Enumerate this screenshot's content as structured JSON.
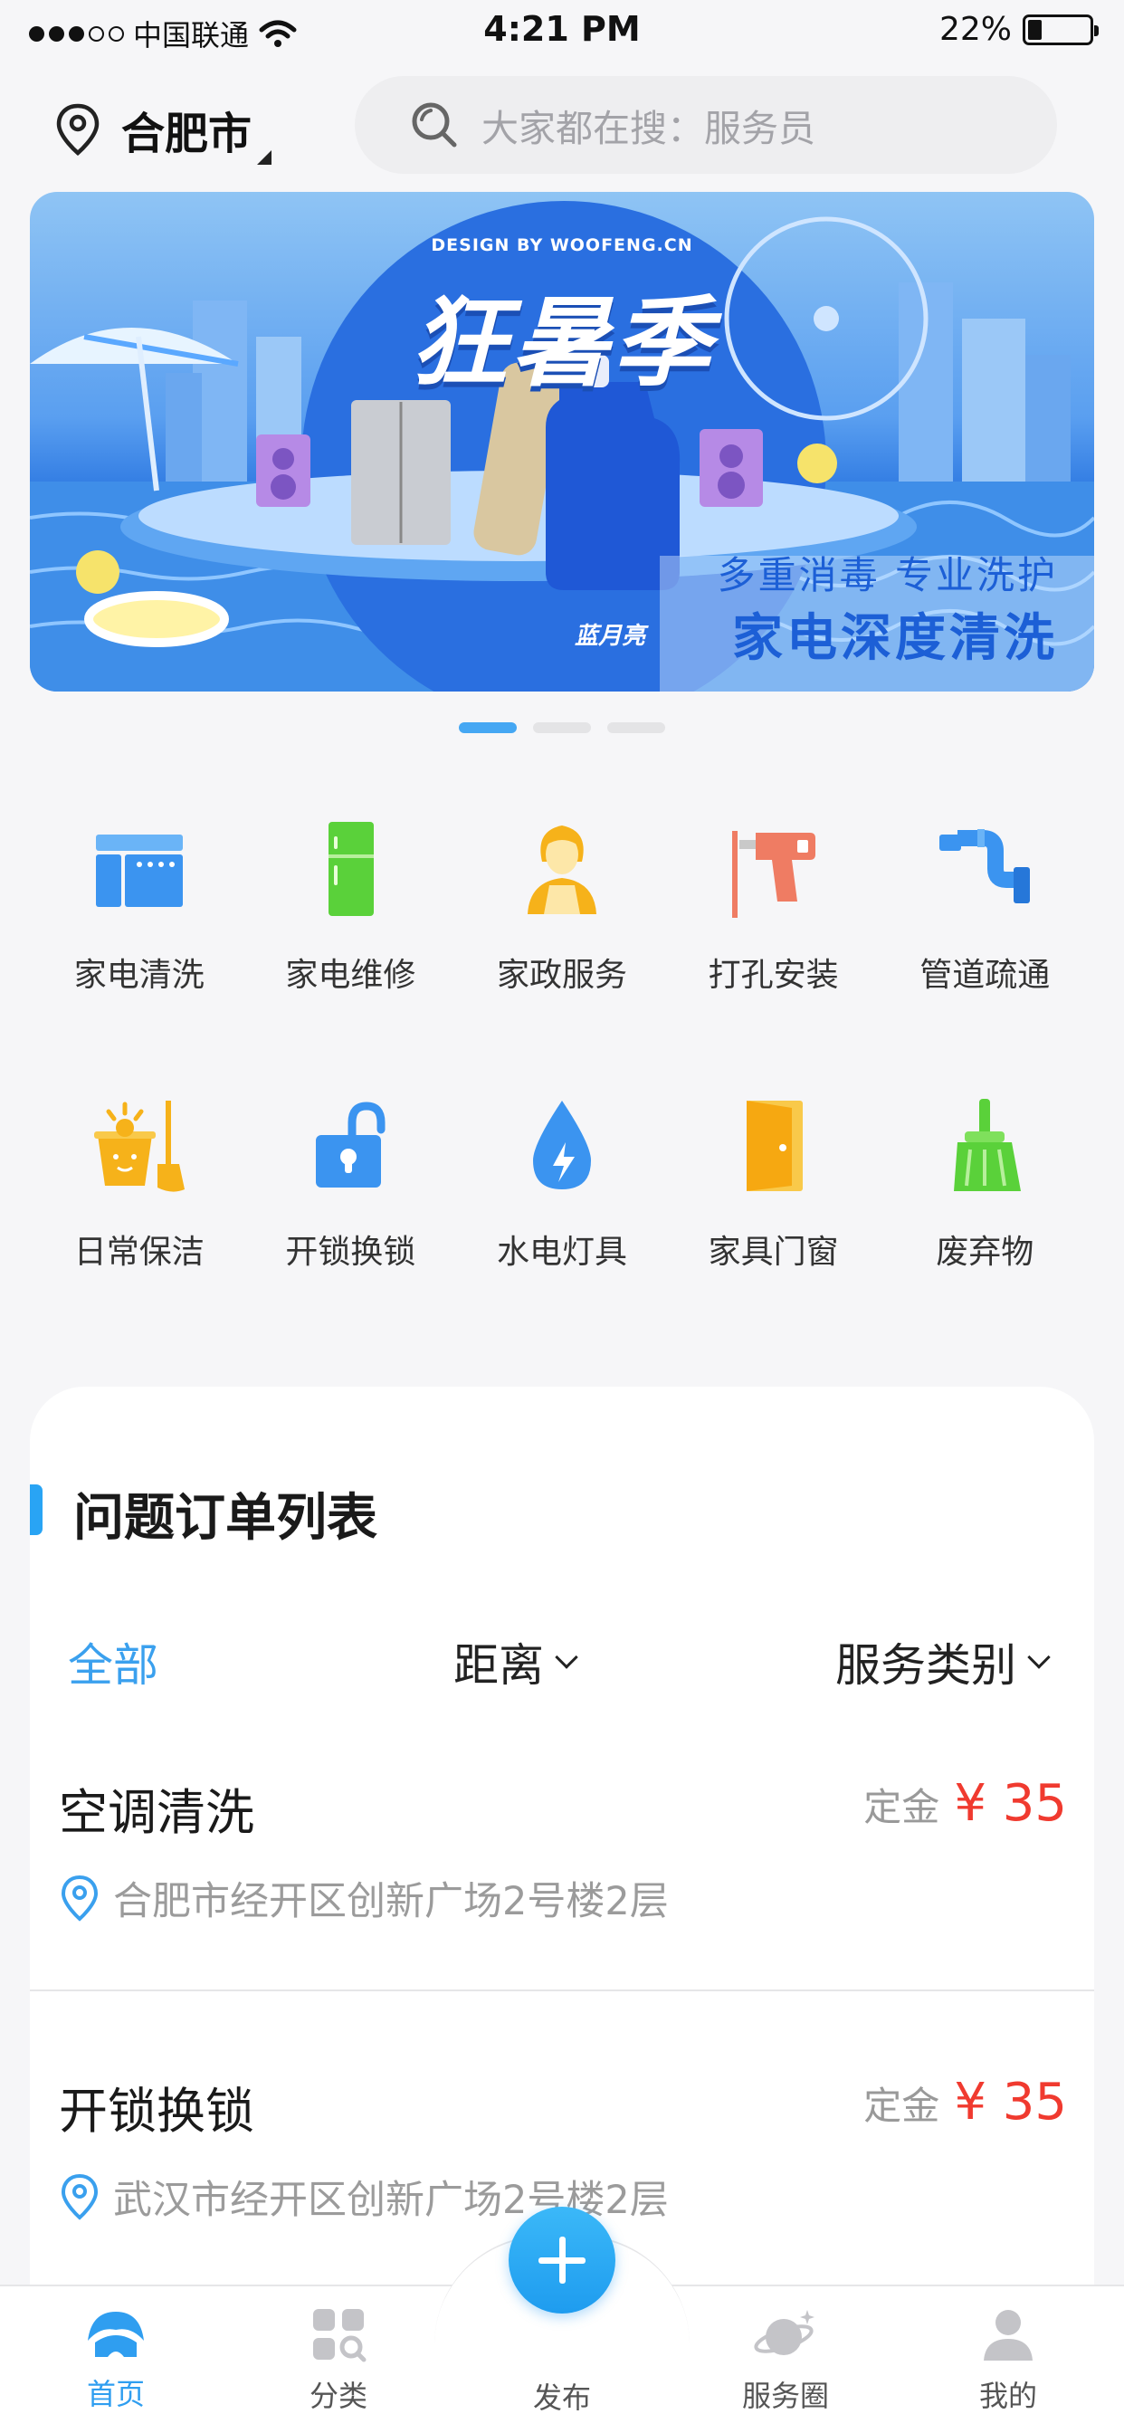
{
  "status_bar": {
    "carrier": "中国联通",
    "time": "4:21 PM",
    "battery_text": "22%",
    "battery_level": 0.22
  },
  "header": {
    "city": "合肥市",
    "search_placeholder": "大家都在搜：服务员"
  },
  "banner": {
    "design_credit": "DESIGN BY WOOFENG.CN",
    "title": "狂暑季",
    "subtitle": "多重消毒  专业洗护",
    "headline": "家电深度清洗",
    "product_label": "蓝月亮",
    "page_count": 3,
    "active_page": 1
  },
  "categories": [
    {
      "label": "家电清洗",
      "icon": "appliance-cleaning-icon",
      "color": "#3b94f0"
    },
    {
      "label": "家电维修",
      "icon": "fridge-repair-icon",
      "color": "#5ad13a"
    },
    {
      "label": "家政服务",
      "icon": "housekeeper-icon",
      "color": "#f6b21a"
    },
    {
      "label": "打孔安装",
      "icon": "drill-icon",
      "color": "#ef7c63"
    },
    {
      "label": "管道疏通",
      "icon": "pipe-icon",
      "color": "#3b94f0"
    },
    {
      "label": "日常保洁",
      "icon": "cleaning-bucket-icon",
      "color": "#f6b21a"
    },
    {
      "label": "开锁换锁",
      "icon": "unlock-icon",
      "color": "#3b94f0"
    },
    {
      "label": "水电灯具",
      "icon": "water-electric-icon",
      "color": "#3b94f0"
    },
    {
      "label": "家具门窗",
      "icon": "door-icon",
      "color": "#f6b21a"
    },
    {
      "label": "废弃物",
      "icon": "broom-icon",
      "color": "#5ad13a"
    }
  ],
  "orders_section": {
    "title": "问题订单列表",
    "filters": {
      "all": "全部",
      "distance": "距离",
      "service_type": "服务类别"
    },
    "orders": [
      {
        "name": "空调清洗",
        "deposit_label": "定金",
        "price": "¥ 35",
        "address": "合肥市经开区创新广场2号楼2层"
      },
      {
        "name": "开锁换锁",
        "deposit_label": "定金",
        "price": "¥ 35",
        "address": "武汉市经开区创新广场2号楼2层"
      }
    ]
  },
  "tabbar": {
    "home": "首页",
    "category": "分类",
    "publish": "发布",
    "circle": "服务圈",
    "mine": "我的",
    "active": "home",
    "active_color": "#2f9ef0"
  }
}
